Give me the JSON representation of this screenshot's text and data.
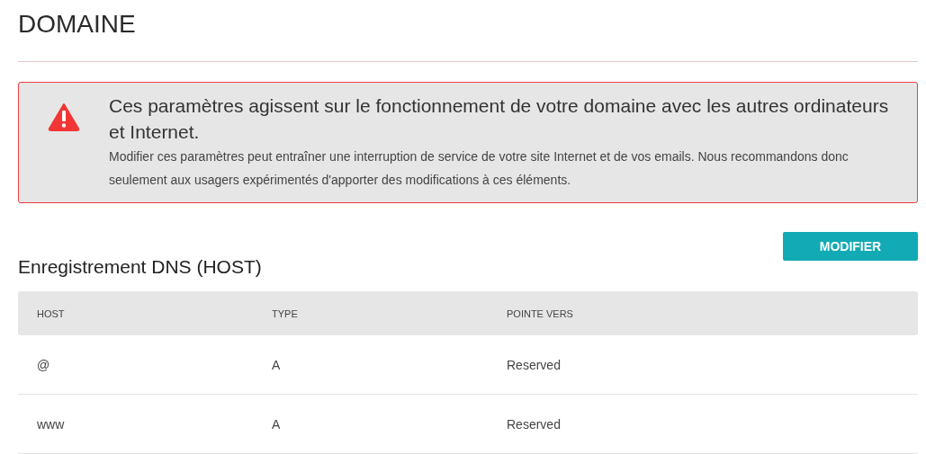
{
  "page": {
    "title": "DOMAINE"
  },
  "alert": {
    "heading": "Ces paramètres agissent sur le fonctionnement de votre domaine avec les autres ordinateurs et Internet.",
    "body": "Modifier ces paramètres peut entraîner une interruption de service de votre site Internet et de vos emails. Nous recommandons donc seulement aux usagers expérimentés d'apporter des modifications à ces éléments."
  },
  "section": {
    "title": "Enregistrement DNS (HOST)",
    "button": "MODIFIER"
  },
  "table": {
    "columns": [
      "HOST",
      "TYPE",
      "POINTE VERS"
    ],
    "rows": [
      [
        "@",
        "A",
        "Reserved"
      ],
      [
        "www",
        "A",
        "Reserved"
      ]
    ]
  }
}
